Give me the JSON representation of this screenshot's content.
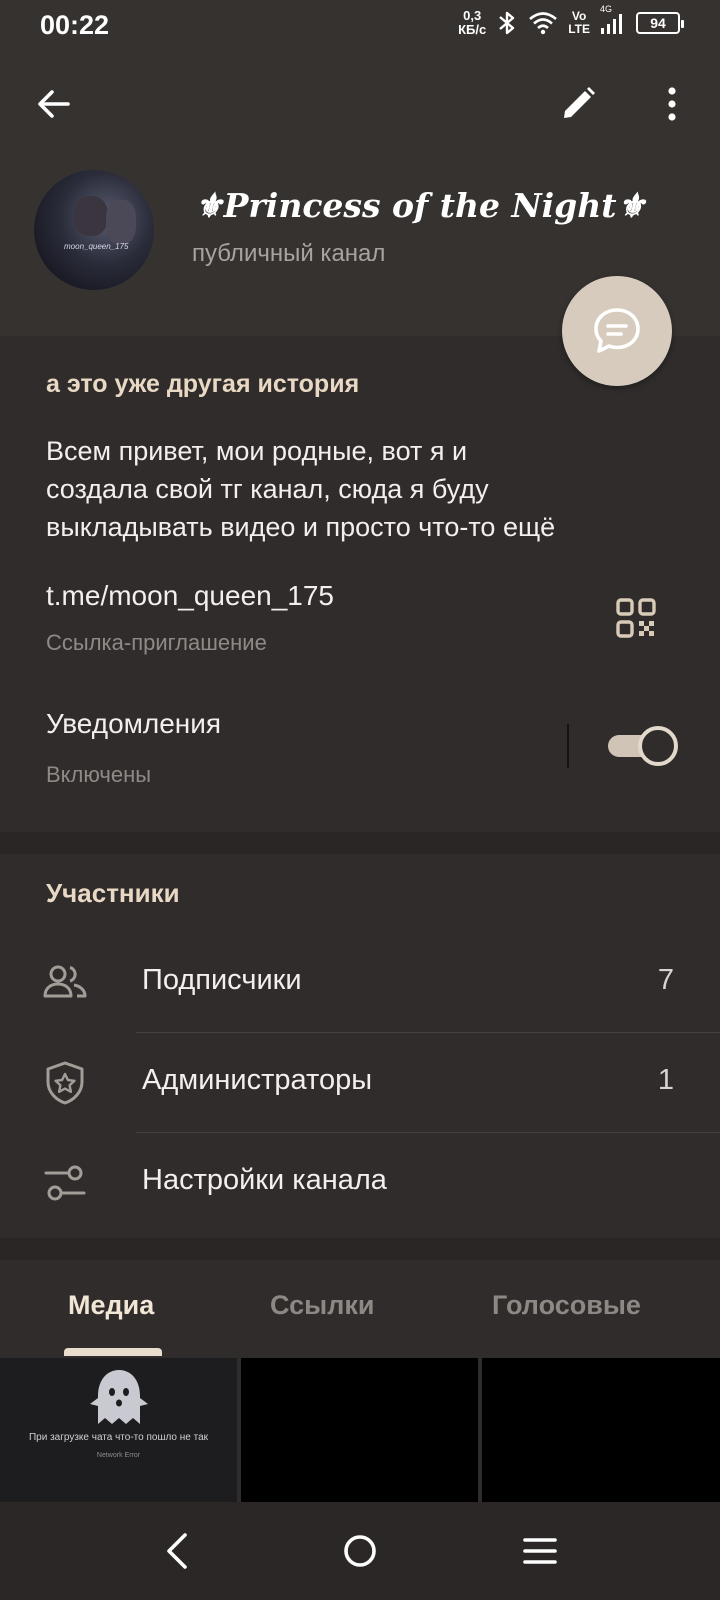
{
  "status_bar": {
    "time": "00:22",
    "net_speed_value": "0,3",
    "net_speed_unit": "КБ/с",
    "volte_top": "Vo",
    "volte_bottom": "LTE",
    "network_type": "4G",
    "battery": "94",
    "icons": [
      "bluetooth-icon",
      "wifi-icon",
      "signal-icon",
      "battery-icon"
    ]
  },
  "header": {
    "channel_title": "⚜Princess of the Night⚜",
    "channel_type": "публичный канал",
    "avatar_caption": "moon_queen_175"
  },
  "info": {
    "about_title": "а это уже другая история",
    "description_lines": [
      "Всем привет, мои родные, вот я и",
      "создала свой тг канал, сюда я буду",
      "выкладывать видео и просто что-то ещё"
    ],
    "invite_link": "t.me/moon_queen_175",
    "invite_link_label": "Ссылка-приглашение",
    "notifications_label": "Уведомления",
    "notifications_state": "Включены",
    "notifications_enabled": true
  },
  "members": {
    "title": "Участники",
    "rows": [
      {
        "label": "Подписчики",
        "count": "7",
        "icon": "people-icon"
      },
      {
        "label": "Администраторы",
        "count": "1",
        "icon": "shield-star-icon"
      },
      {
        "label": "Настройки канала",
        "count": "",
        "icon": "settings-sliders-icon"
      }
    ]
  },
  "tabs": {
    "items": [
      "Медиа",
      "Ссылки",
      "Голосовые"
    ],
    "active": "Медиа"
  },
  "media": {
    "error_text": "При загрузке чата что-то пошло не так",
    "error_sub": "Network Error"
  },
  "colors": {
    "accent": "#e9d9c4",
    "fab": "#d6cbbd",
    "background": "#2f2c2b",
    "header": "#363230"
  }
}
